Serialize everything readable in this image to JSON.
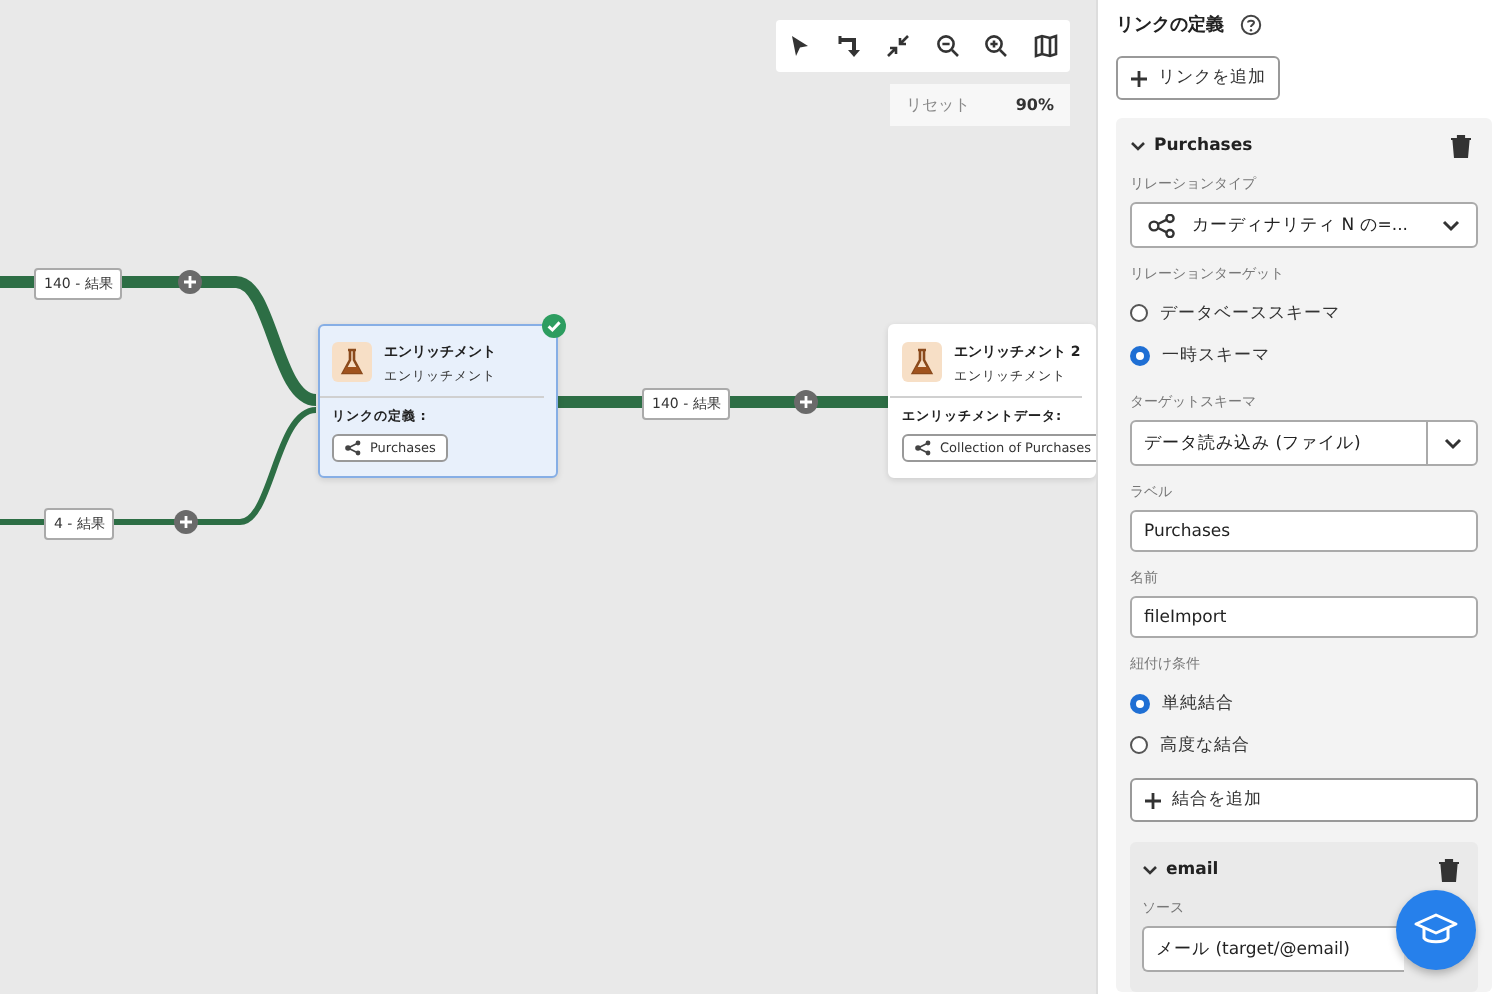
{
  "canvas": {
    "zoom": {
      "reset_label": "リセット",
      "value": "90%"
    },
    "edges": [
      {
        "label": "140 - 結果"
      },
      {
        "label": "4 - 結果"
      },
      {
        "label": "140 - 結果"
      }
    ],
    "nodes": [
      {
        "title": "エンリッチメント",
        "subtitle": "エンリッチメント",
        "section_label": "リンクの定義 :",
        "chip": "Purchases",
        "selected": true,
        "validated": true
      },
      {
        "title": "エンリッチメント 2",
        "subtitle": "エンリッチメント",
        "section_label": "エンリッチメントデータ:",
        "chip": "Collection of Purchases",
        "selected": false,
        "validated": false
      }
    ]
  },
  "panel": {
    "title": "リンクの定義",
    "add_link_button": "リンクを追加",
    "links": [
      {
        "name": "Purchases",
        "expanded": true,
        "relation_type_label": "リレーションタイプ",
        "relation_type_value": "カーディナリティ N の=...",
        "relation_target_label": "リレーションターゲット",
        "relation_targets": [
          {
            "label": "データベーススキーマ",
            "selected": false
          },
          {
            "label": "一時スキーマ",
            "selected": true
          }
        ],
        "target_schema_label": "ターゲットスキーマ",
        "target_schema_value": "データ読み込み (ファイル)",
        "label_label": "ラベル",
        "label_value": "Purchases",
        "name_label": "名前",
        "name_value": "fileImport",
        "join_label": "紐付け条件",
        "join_types": [
          {
            "label": "単純結合",
            "selected": true
          },
          {
            "label": "高度な結合",
            "selected": false
          }
        ],
        "add_join_button": "結合を追加",
        "joins": [
          {
            "name": "email",
            "expanded": true,
            "source_label": "ソース",
            "source_value": "メール (target/@email)"
          }
        ]
      }
    ]
  }
}
